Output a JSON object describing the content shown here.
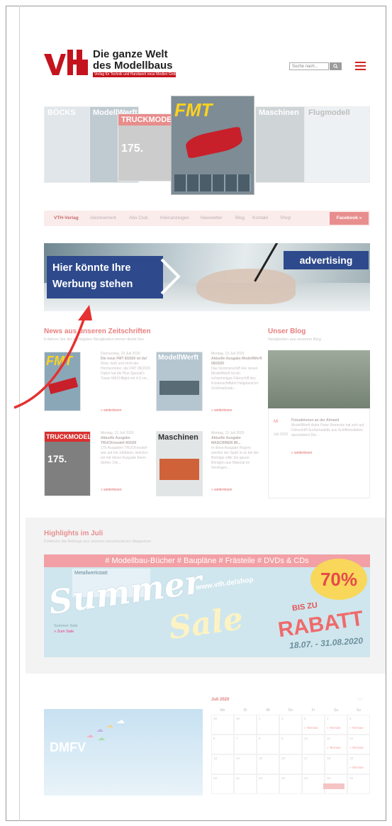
{
  "header": {
    "logo_mark": "vth",
    "logo_line1": "Die ganze Welt",
    "logo_line2": "des Modellbaus",
    "logo_sub": "Verlag für Technik und Handwerk neue Medien GmbH",
    "search_placeholder": "Suche nach...",
    "search_button_icon": "search-icon",
    "menu_icon": "hamburger-icon"
  },
  "collage": {
    "magazines": [
      "BÖCKS",
      "ModellWerft",
      "TRUCKMODELL",
      "FMT",
      "Maschinen",
      "Flugmodell"
    ],
    "issue_label": "175.",
    "fmt_title": "FMT"
  },
  "nav": {
    "items": [
      "VTH-Verlag",
      "Abonnement",
      "Abo Club",
      "Kleinanzeigen",
      "Newsletter",
      "Blog",
      "Kontakt",
      "Shop"
    ],
    "facebook_label": "Facebook  »"
  },
  "ad": {
    "line1": "Hier könnte Ihre",
    "line2": "Werbung stehen",
    "label": "advertising"
  },
  "news": {
    "title": "News aus unseren Zeitschriften",
    "subtitle": "Erfahren Sie die wichtigsten Neuigkeiten immer direkt hier",
    "items": [
      {
        "date": "Donnerstag, 23 Juli 2020",
        "headline": "Die neue FMT 8/2020 ist da!",
        "text": "Wow, heiß und nicht der Hochsommer, die FMT 08/2020. Dabei hat die Plus Spezial's Trawe MACHflight mit 4,0 cm...",
        "more": "» weiterlesen",
        "cover": "FMT"
      },
      {
        "date": "Montag, 13 Juli 2020",
        "headline": "Aktuelle Ausgabe ModellWerft 08/2020",
        "text": "Das Sommerschiff des neuen ModellWerft ist ein schwimmiges Fährschiff des Küstenschiffahrt Helgoland im Großmaßstab...",
        "more": "» weiterlesen",
        "cover": "ModellWerft"
      },
      {
        "date": "Montag, 13 Juli 2020",
        "headline": "Aktuelle Ausgabe TRUCKmodell 4/2020",
        "text": "175 Ausgaben TRUCKmodell - wer auf ein Jubiläum, welches wir mit dieser Ausgabe feiern dürfen. Die...",
        "more": "» weiterlesen",
        "cover": "TRUCKMODELL"
      },
      {
        "date": "Montag, 13 Juli 2020",
        "headline": "Aktuelle Ausgabe MASCHINEN IM...",
        "text": "In diese Ausgabe Rogers werden der Spaß in so bei der Beiträge zitlik Sie gaune Bördgen aus Material im Versingen...",
        "more": "» weiterlesen",
        "cover": "Maschinen"
      }
    ]
  },
  "blog": {
    "title": "Unser Blog",
    "subtitle": "Neuigkeiten aus unserem Blog",
    "post_title": "Fotoaktionen an der Ahrweit",
    "post_text": "ModellWerft Autor Peter Reinecke hat sich auf Fährschiff Großemodelle aus Schiffsmodellen spezialisiert Die...",
    "post_date": "Juli 2020",
    "more": "» weiterlesen",
    "side_letters": "Mi"
  },
  "highlights": {
    "title": "Highlights im Juli",
    "subtitle": "Entdecke die Beiträge aus unseren verschiedenen Magazinen",
    "banner_top": "# Modellbau-Bücher  # Baupläne  # Frästeile  # DVDs & CDs",
    "summer": "Summer",
    "sale": "Sale",
    "url": "www.vth.de/shop",
    "percent": "70%",
    "bis": "BIS ZU",
    "rabatt": "RABATT",
    "date_range": "18.07. - 31.08.2020",
    "caption": "Summer-Sale",
    "caption_link": "» Zum Sale",
    "mag_label": "Metallwerkstatt"
  },
  "footer_left": {
    "logo_text": "DMFV"
  },
  "calendar": {
    "title": "Juli 2020",
    "nav": "‹ ›",
    "weekdays": [
      "Mo",
      "Di",
      "Mi",
      "Do",
      "Fr",
      "Sa",
      "So"
    ],
    "weeks": [
      [
        "29",
        "30",
        "1",
        "2",
        "3",
        "4",
        "5"
      ],
      [
        "6",
        "7",
        "8",
        "9",
        "10",
        "11",
        "12"
      ],
      [
        "13",
        "14",
        "15",
        "16",
        "17",
        "18",
        "19"
      ],
      [
        "20",
        "21",
        "22",
        "23",
        "24",
        "25",
        "26"
      ]
    ],
    "event_label": "» Termine"
  }
}
